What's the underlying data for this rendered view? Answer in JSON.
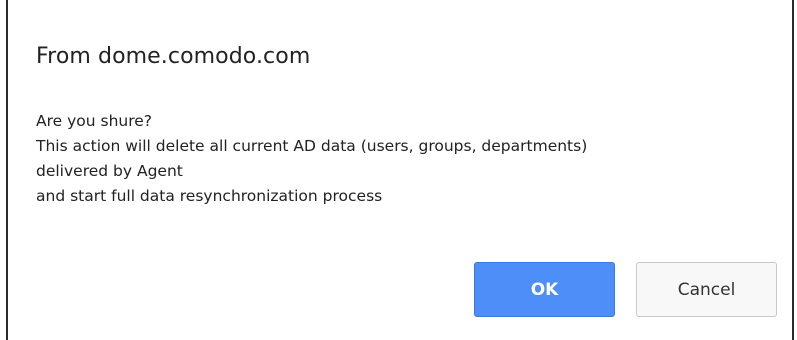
{
  "dialog": {
    "title": "From dome.comodo.com",
    "message_lines": [
      "Are you shure?",
      "This action will delete all current AD data (users, groups, departments)",
      "delivered by Agent",
      "and start full data resynchronization process"
    ],
    "ok_label": "OK",
    "cancel_label": "Cancel"
  },
  "colors": {
    "ok_button_bg": "#4d8ef8",
    "ok_button_text": "#ffffff",
    "cancel_button_bg": "#f8f8f8",
    "text": "#222222"
  }
}
